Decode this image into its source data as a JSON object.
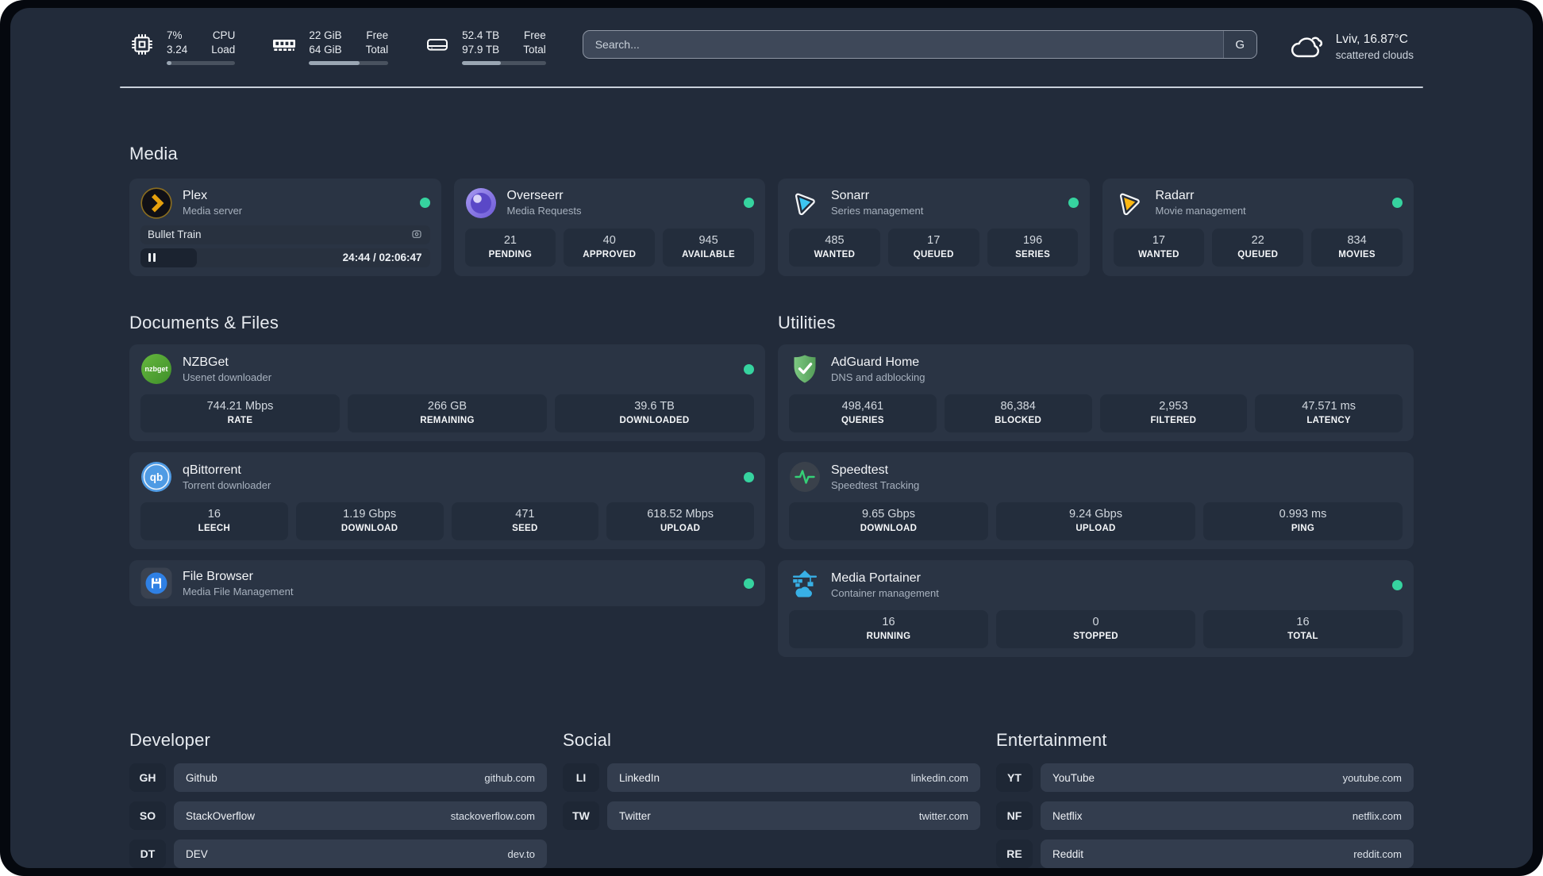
{
  "colors": {
    "status_online": "#36d39f",
    "panel_bg": "#222b3a",
    "card_bg": "#2a3444",
    "plex_brand": "#e5a00d",
    "overseerr_brand": "#6d59d6",
    "sonarr_brand": "#3cc5f1",
    "radarr_brand": "#fcb712",
    "nzbget_brand": "#4da32f",
    "qbittorrent_brand": "#4f9be4",
    "filebrowser_brand": "#2f80e4",
    "adguard_brand": "#68bb6a",
    "speedtest_accent": "#35d077",
    "portainer_brand": "#38b0e6"
  },
  "topbar": {
    "cpu": {
      "value_line1": "7%",
      "value_line2": "3.24",
      "label_line1": "CPU",
      "label_line2": "Load",
      "progress_pct": 7
    },
    "memory": {
      "value_line1": "22 GiB",
      "value_line2": "64 GiB",
      "label_line1": "Free",
      "label_line2": "Total",
      "progress_pct": 64
    },
    "disk": {
      "value_line1": "52.4 TB",
      "value_line2": "97.9 TB",
      "label_line1": "Free",
      "label_line2": "Total",
      "progress_pct": 46
    },
    "search": {
      "placeholder": "Search...",
      "button_label": "G"
    },
    "weather": {
      "location": "Lviv, 16.87°C",
      "condition": "scattered clouds"
    }
  },
  "media": {
    "heading": "Media",
    "plex": {
      "name": "Plex",
      "description": "Media server",
      "status": "online",
      "now_playing": {
        "title": "Bullet Train",
        "time": "24:44 / 02:06:47",
        "progress_pct": 19.5,
        "state": "paused"
      }
    },
    "overseerr": {
      "name": "Overseerr",
      "description": "Media Requests",
      "status": "online",
      "stats": [
        {
          "value": "21",
          "label": "PENDING"
        },
        {
          "value": "40",
          "label": "APPROVED"
        },
        {
          "value": "945",
          "label": "AVAILABLE"
        }
      ]
    },
    "sonarr": {
      "name": "Sonarr",
      "description": "Series management",
      "status": "online",
      "stats": [
        {
          "value": "485",
          "label": "WANTED"
        },
        {
          "value": "17",
          "label": "QUEUED"
        },
        {
          "value": "196",
          "label": "SERIES"
        }
      ]
    },
    "radarr": {
      "name": "Radarr",
      "description": "Movie management",
      "status": "online",
      "stats": [
        {
          "value": "17",
          "label": "WANTED"
        },
        {
          "value": "22",
          "label": "QUEUED"
        },
        {
          "value": "834",
          "label": "MOVIES"
        }
      ]
    }
  },
  "documents": {
    "heading": "Documents & Files",
    "nzbget": {
      "name": "NZBGet",
      "description": "Usenet downloader",
      "status": "online",
      "stats": [
        {
          "value": "744.21 Mbps",
          "label": "RATE"
        },
        {
          "value": "266 GB",
          "label": "REMAINING"
        },
        {
          "value": "39.6 TB",
          "label": "DOWNLOADED"
        }
      ]
    },
    "qbittorrent": {
      "name": "qBittorrent",
      "description": "Torrent downloader",
      "status": "online",
      "stats": [
        {
          "value": "16",
          "label": "LEECH"
        },
        {
          "value": "1.19 Gbps",
          "label": "DOWNLOAD"
        },
        {
          "value": "471",
          "label": "SEED"
        },
        {
          "value": "618.52 Mbps",
          "label": "UPLOAD"
        }
      ]
    },
    "filebrowser": {
      "name": "File Browser",
      "description": "Media File Management",
      "status": "online"
    }
  },
  "utilities": {
    "heading": "Utilities",
    "adguard": {
      "name": "AdGuard Home",
      "description": "DNS and adblocking",
      "stats": [
        {
          "value": "498,461",
          "label": "QUERIES"
        },
        {
          "value": "86,384",
          "label": "BLOCKED"
        },
        {
          "value": "2,953",
          "label": "FILTERED"
        },
        {
          "value": "47.571 ms",
          "label": "LATENCY"
        }
      ]
    },
    "speedtest": {
      "name": "Speedtest",
      "description": "Speedtest Tracking",
      "stats": [
        {
          "value": "9.65 Gbps",
          "label": "DOWNLOAD"
        },
        {
          "value": "9.24 Gbps",
          "label": "UPLOAD"
        },
        {
          "value": "0.993 ms",
          "label": "PING"
        }
      ]
    },
    "portainer": {
      "name": "Media Portainer",
      "description": "Container management",
      "status": "online",
      "stats": [
        {
          "value": "16",
          "label": "RUNNING"
        },
        {
          "value": "0",
          "label": "STOPPED"
        },
        {
          "value": "16",
          "label": "TOTAL"
        }
      ]
    }
  },
  "bookmarks": [
    {
      "heading": "Developer",
      "items": [
        {
          "abbr": "GH",
          "name": "Github",
          "url": "github.com"
        },
        {
          "abbr": "SO",
          "name": "StackOverflow",
          "url": "stackoverflow.com"
        },
        {
          "abbr": "DT",
          "name": "DEV",
          "url": "dev.to"
        }
      ]
    },
    {
      "heading": "Social",
      "items": [
        {
          "abbr": "LI",
          "name": "LinkedIn",
          "url": "linkedin.com"
        },
        {
          "abbr": "TW",
          "name": "Twitter",
          "url": "twitter.com"
        }
      ]
    },
    {
      "heading": "Entertainment",
      "items": [
        {
          "abbr": "YT",
          "name": "YouTube",
          "url": "youtube.com"
        },
        {
          "abbr": "NF",
          "name": "Netflix",
          "url": "netflix.com"
        },
        {
          "abbr": "RE",
          "name": "Reddit",
          "url": "reddit.com"
        }
      ]
    }
  ]
}
